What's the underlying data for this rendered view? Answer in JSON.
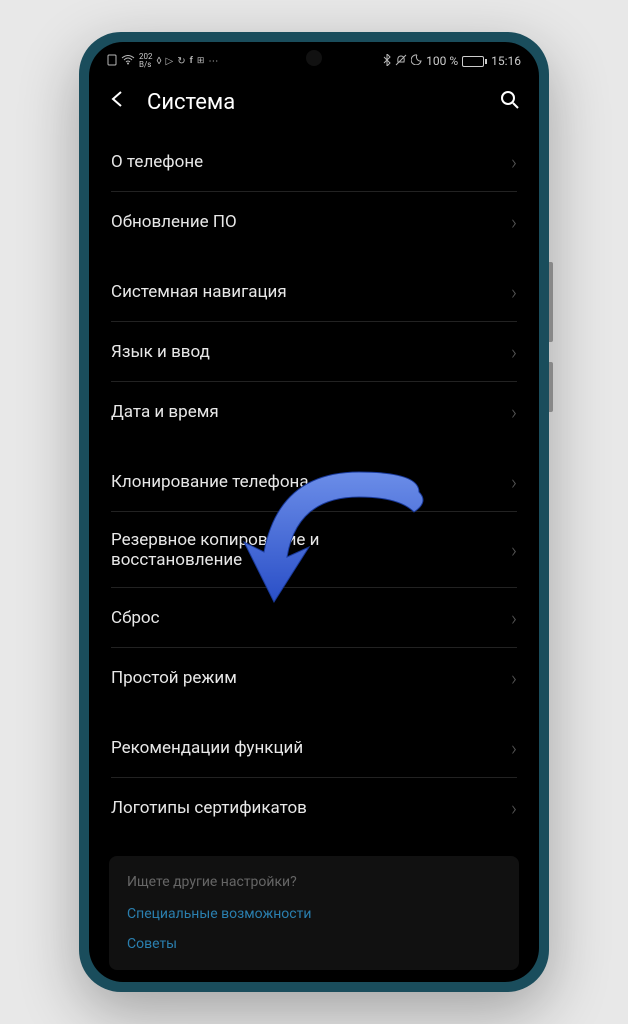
{
  "status": {
    "speed_val": "202",
    "speed_unit": "B/s",
    "battery_pct": "100 %",
    "time": "15:16"
  },
  "header": {
    "title": "Система"
  },
  "items": {
    "about": "О телефоне",
    "update": "Обновление ПО",
    "nav": "Системная навигация",
    "lang": "Язык и ввод",
    "datetime": "Дата и время",
    "clone": "Клонирование телефона",
    "backup": "Резервное копирование и восстановление",
    "reset": "Сброс",
    "simple": "Простой режим",
    "recs": "Рекомендации функций",
    "certs": "Логотипы сертификатов"
  },
  "footer": {
    "prompt": "Ищете другие настройки?",
    "accessibility": "Специальные возможности",
    "tips": "Советы"
  }
}
